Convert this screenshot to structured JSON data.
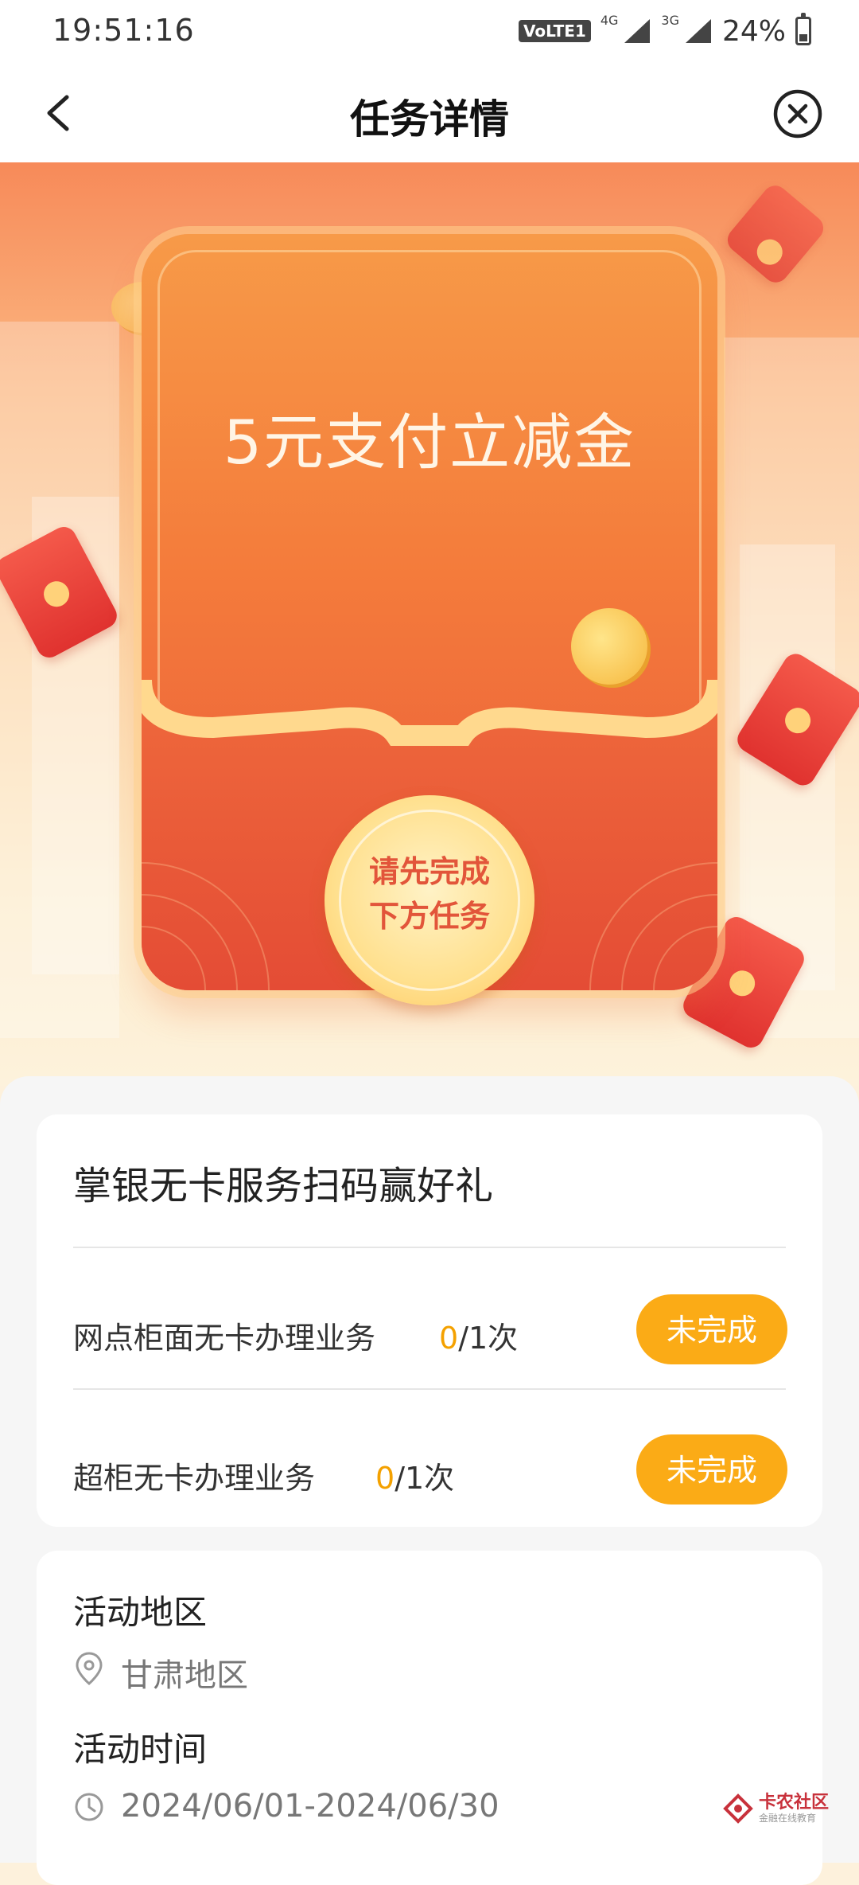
{
  "status_bar": {
    "time": "19:51:16",
    "volte": "VoLTE1",
    "net1": "4G",
    "net2": "3G",
    "battery": "24%"
  },
  "nav": {
    "title": "任务详情",
    "back_icon": "chevron-left-icon",
    "close_icon": "close-circle-icon"
  },
  "banner": {
    "reward_title": "5元支付立减金",
    "seal_line1": "请先完成",
    "seal_line2": "下方任务"
  },
  "task_card": {
    "title": "掌银无卡服务扫码赢好礼",
    "tasks": [
      {
        "name": "网点柜面无卡办理业务",
        "done": "0",
        "total": "/1次",
        "status": "未完成"
      },
      {
        "name": "超柜无卡办理业务",
        "done": "0",
        "total": "/1次",
        "status": "未完成"
      }
    ]
  },
  "info": {
    "region_label": "活动地区",
    "region_value": "甘肃地区",
    "time_label": "活动时间",
    "time_value": "2024/06/01-2024/06/30"
  },
  "watermark": {
    "name": "卡农社区",
    "slogan": "金融在线教育"
  },
  "colors": {
    "accent": "#fbab16",
    "progress_done": "#f4a100",
    "packet_red": "#e9563a"
  }
}
